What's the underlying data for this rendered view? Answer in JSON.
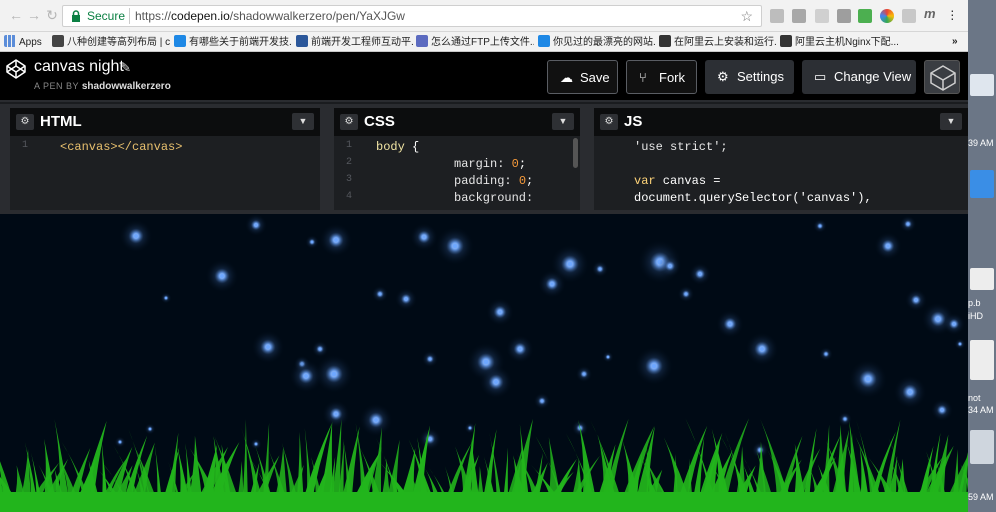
{
  "browser": {
    "secure_label": "Secure",
    "url_prefix": "https://",
    "url_host": "codepen.io",
    "url_path": "/shadowwalkerzero/pen/YaXJGw"
  },
  "bookmarks": [
    {
      "label": "Apps",
      "color": "#5b8dd9"
    },
    {
      "label": "八种创建等高列布局 | c...",
      "color": "#444"
    },
    {
      "label": "有哪些关于前端开发技...",
      "color": "#1e88e5"
    },
    {
      "label": "前端开发工程师互动平...",
      "color": "#2b579a"
    },
    {
      "label": "怎么通过FTP上传文件...",
      "color": "#5c6bc0"
    },
    {
      "label": "你见过的最漂亮的网站...",
      "color": "#1e88e5"
    },
    {
      "label": "在阿里云上安装和运行...",
      "color": "#333"
    },
    {
      "label": "阿里云主机Nginx下配...",
      "color": "#333"
    },
    {
      "label": "»",
      "color": ""
    }
  ],
  "header": {
    "title": "canvas night",
    "author_prefix": "A PEN BY",
    "author": "shadowwalkerzero",
    "save_label": "Save",
    "fork_label": "Fork",
    "settings_label": "Settings",
    "change_view_label": "Change View"
  },
  "editors": {
    "html": {
      "title": "HTML",
      "line1": "1",
      "code1": "<canvas></canvas>"
    },
    "css": {
      "title": "CSS",
      "lines": [
        "1",
        "2",
        "3",
        "4"
      ],
      "code1_sel": "body",
      "code1_brace": " {",
      "margin_prop": "margin:",
      "margin_val": "0",
      "padding_prop": "padding:",
      "padding_val": "0",
      "bg_prop": "background:"
    },
    "js": {
      "title": "JS",
      "code1": "'use strict';",
      "code3_kw": "var",
      "code3_rest": " canvas =",
      "code4": "document.querySelector('canvas'),"
    }
  },
  "desktop": {
    "t1": "39 AM",
    "t2": "p.b",
    "t3": "iHD",
    "t4": "not",
    "t5": "34 AM",
    "t6": "59 AM"
  },
  "colors": {
    "header_bg": "#000000",
    "editor_bg": "#1d1f22",
    "canvas_bg": "#000a15",
    "grass": "#22b51c",
    "firefly": "#6fa8ff"
  }
}
